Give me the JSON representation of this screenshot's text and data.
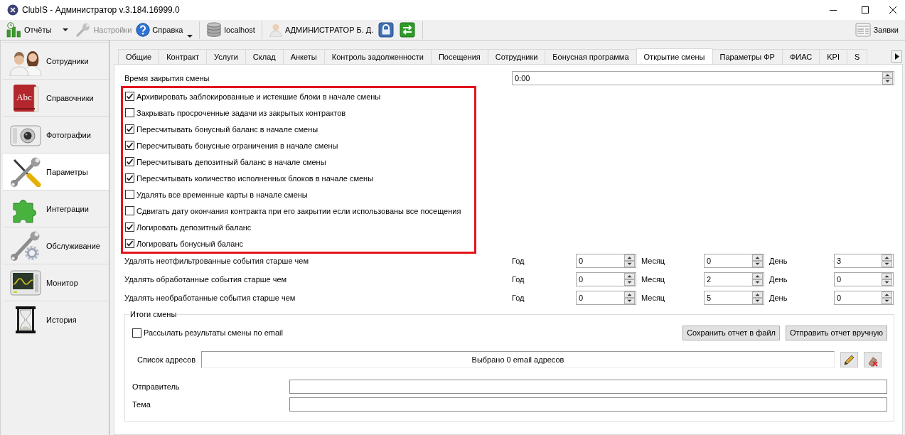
{
  "window": {
    "title": "ClubIS - Администратор v.3.184.16999.0"
  },
  "toolbar": {
    "groups": [
      [
        {
          "kind": "split",
          "label": "Отчёты",
          "disabled": false
        },
        {
          "kind": "plain",
          "label": "Настройки",
          "disabled": true
        },
        {
          "kind": "menu",
          "label": "Справка",
          "disabled": false
        }
      ],
      [
        {
          "kind": "plain",
          "label": "localhost",
          "disabled": false
        }
      ],
      [
        {
          "kind": "plain",
          "label": "АДМИНИСТРАТОР Б. Д.",
          "disabled": false
        },
        {
          "kind": "icon",
          "disabled": false
        },
        {
          "kind": "icon",
          "disabled": false
        }
      ]
    ],
    "right": [
      {
        "kind": "plain",
        "label": "Заявки",
        "disabled": false
      }
    ]
  },
  "sidebar": {
    "items": [
      {
        "label": "Сотрудники",
        "selected": false
      },
      {
        "label": "Справочники",
        "selected": false,
        "icon_text": "Abc"
      },
      {
        "label": "Фотографии",
        "selected": false
      },
      {
        "label": "Параметры",
        "selected": true
      },
      {
        "label": "Интеграции",
        "selected": false
      },
      {
        "label": "Обслуживание",
        "selected": false
      },
      {
        "label": "Монитор",
        "selected": false
      },
      {
        "label": "История",
        "selected": false
      }
    ]
  },
  "tabs": [
    {
      "label": "Общие",
      "selected": false
    },
    {
      "label": "Контракт",
      "selected": false
    },
    {
      "label": "Услуги",
      "selected": false
    },
    {
      "label": "Склад",
      "selected": false
    },
    {
      "label": "Анкеты",
      "selected": false
    },
    {
      "label": "Контроль задолженности",
      "selected": false
    },
    {
      "label": "Посещения",
      "selected": false
    },
    {
      "label": "Сотрудники",
      "selected": false
    },
    {
      "label": "Бонусная программа",
      "selected": false
    },
    {
      "label": "Открытие смены",
      "selected": true
    },
    {
      "label": "Параметры ФР",
      "selected": false
    },
    {
      "label": "ФИАС",
      "selected": false
    },
    {
      "label": "KPI",
      "selected": false
    },
    {
      "label": "S",
      "selected": false
    }
  ],
  "settings": {
    "close_time": {
      "label": "Время закрытия смены",
      "value": "0:00"
    },
    "checkbox_group": {
      "highlighted": true,
      "items": [
        {
          "label": "Архивировать заблокированные и истекшие блоки в начале смены",
          "checked": true
        },
        {
          "label": "Закрывать просроченные задачи из закрытых контрактов",
          "checked": false
        },
        {
          "label": "Пересчитывать бонусный баланс в начале смены",
          "checked": true
        },
        {
          "label": "Пересчитывать бонусные ограничения в начале смены",
          "checked": true
        },
        {
          "label": "Пересчитывать депозитный баланс в начале смены",
          "checked": true
        },
        {
          "label": "Пересчитывать количество исполненных блоков в начале смены",
          "checked": true
        },
        {
          "label": "Удалять все временные карты в начале смены",
          "checked": false
        },
        {
          "label": "Сдвигать дату окончания контракта при его закрытии если использованы все посещения",
          "checked": false
        },
        {
          "label": "Логировать депозитный баланс",
          "checked": true
        },
        {
          "label": "Логировать бонусный баланс",
          "checked": true
        }
      ]
    },
    "cleanup_rows": [
      {
        "label": "Удалять неотфильтрованные события старше чем",
        "fields": [
          {
            "unit": "Год",
            "value": "0"
          },
          {
            "unit": "Месяц",
            "value": "0"
          },
          {
            "unit": "День",
            "value": "3"
          }
        ]
      },
      {
        "label": "Удалять обработанные события старше чем",
        "fields": [
          {
            "unit": "Год",
            "value": "0"
          },
          {
            "unit": "Месяц",
            "value": "2"
          },
          {
            "unit": "День",
            "value": "0"
          }
        ]
      },
      {
        "label": "Удалять необработанные события старше чем",
        "fields": [
          {
            "unit": "Год",
            "value": "0"
          },
          {
            "unit": "Месяц",
            "value": "5"
          },
          {
            "unit": "День",
            "value": "0"
          }
        ]
      }
    ]
  },
  "shift_results": {
    "title": "Итоги смены",
    "email_checkbox": {
      "label": "Рассылать результаты смены по email",
      "checked": false
    },
    "buttons": [
      "Сохранить отчет в файл",
      "Отправить отчет вручную"
    ],
    "address_list": {
      "label": "Список адресов",
      "value": "Выбрано 0 email адресов",
      "tools": [
        {
          "kind": "edit"
        },
        {
          "kind": "clear"
        }
      ]
    },
    "sender": {
      "label": "Отправитель"
    },
    "subject": {
      "label": "Тема"
    }
  }
}
